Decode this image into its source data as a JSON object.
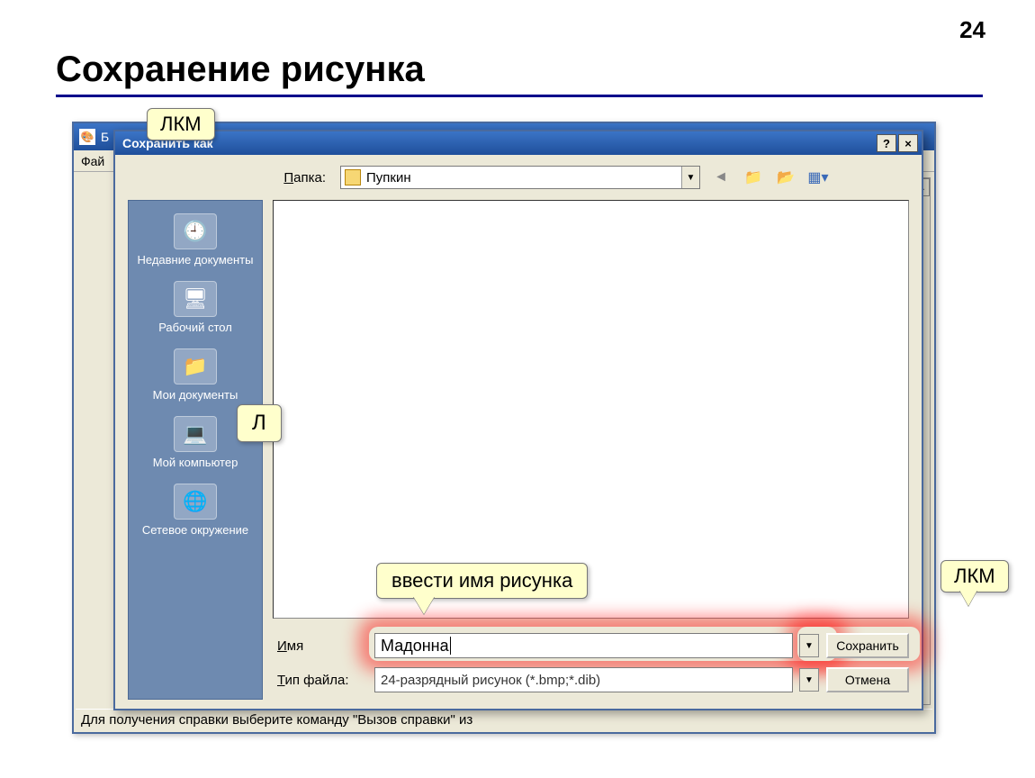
{
  "page_number": "24",
  "slide_title": "Сохранение рисунка",
  "bg_window": {
    "title_prefix": "Б",
    "menu_file": "Фай",
    "statusbar": "Для получения справки выберите команду \"Вызов справки\" из"
  },
  "dialog": {
    "title": "Сохранить как",
    "help_btn": "?",
    "close_btn": "×",
    "folder_label": "Папка:",
    "folder_name": "Пупкин",
    "places": {
      "recent": "Недавние документы",
      "desktop": "Рабочий стол",
      "mydocs": "Мои документы",
      "mycomp": "Мой компьютер",
      "network": "Сетевое окружение"
    },
    "filename_label": "Имя",
    "filename_value": "Мадонна",
    "filetype_label": "Тип файла:",
    "filetype_value": "24-разрядный рисунок (*.bmp;*.dib)",
    "save_btn": "Сохранить",
    "cancel_btn": "Отмена"
  },
  "callouts": {
    "top": "ЛКМ",
    "side": "Л",
    "filename_hint": "ввести имя рисунка",
    "save_hint": "ЛКМ"
  }
}
